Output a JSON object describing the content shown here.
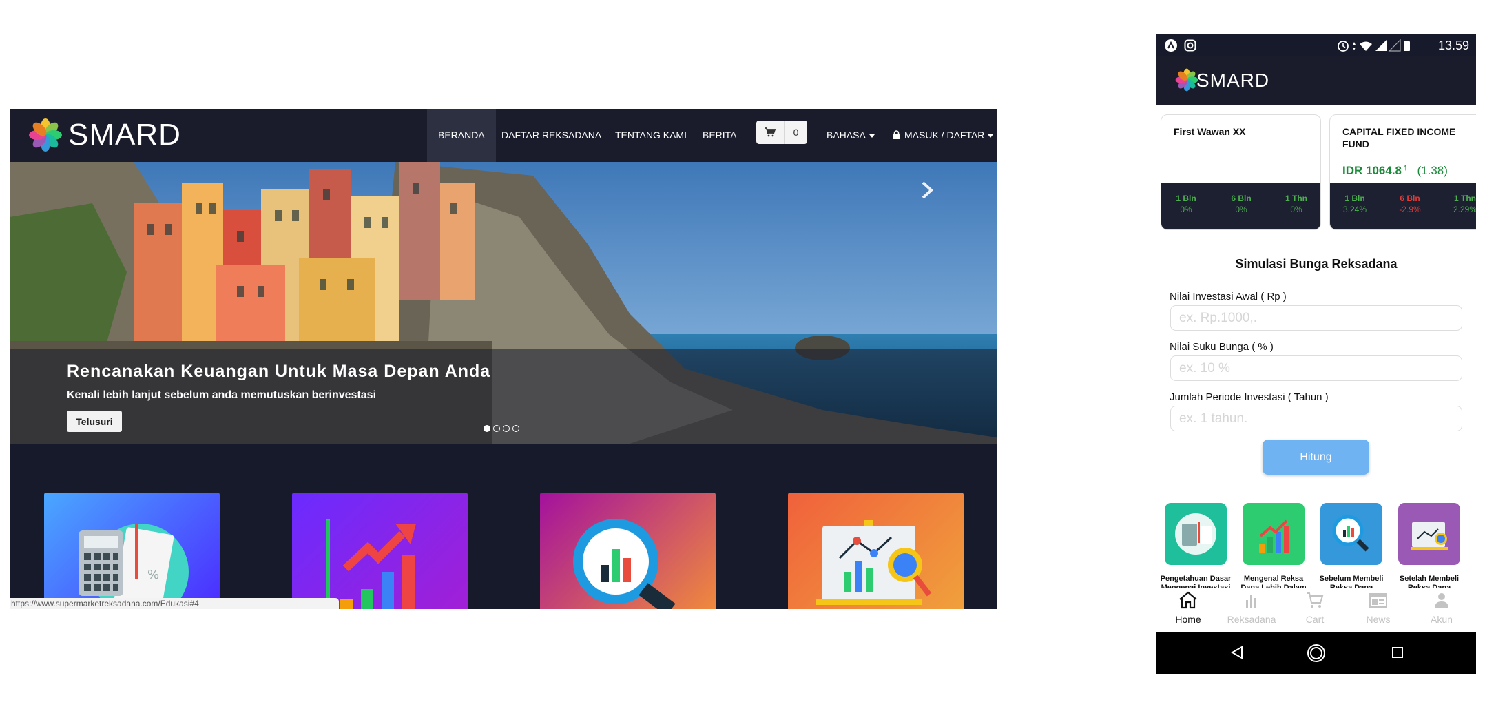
{
  "desktop": {
    "brand": "SMARD",
    "nav": {
      "beranda": "BERANDA",
      "daftar": "DAFTAR REKSADANA",
      "tentang": "TENTANG KAMI",
      "berita": "BERITA",
      "cart_count": "0",
      "bahasa": "BAHASA",
      "masuk": "MASUK / DAFTAR"
    },
    "hero": {
      "title": "Rencanakan Keuangan Untuk Masa Depan Anda",
      "subtitle": "Kenali lebih lanjut sebelum anda memutuskan berinvestasi",
      "button": "Telusuri",
      "active_slide": 1,
      "slide_count": 4
    },
    "status_url": "https://www.supermarketreksadana.com/Edukasi#4",
    "colors": {
      "nav_bg": "#1a1c2b",
      "page_bg": "#171a2a"
    },
    "tile_icons": [
      "calculator-icon",
      "growth-chart-icon",
      "magnifier-chart-icon",
      "presentation-board-icon"
    ]
  },
  "phone": {
    "status_time": "13.59",
    "brand": "SMARD",
    "funds": [
      {
        "name": "First Wawan XX",
        "stats": [
          {
            "label": "1 Bln",
            "value": "0%"
          },
          {
            "label": "6 Bln",
            "value": "0%"
          },
          {
            "label": "1 Thn",
            "value": "0%"
          }
        ]
      },
      {
        "name": "CAPITAL FIXED INCOME FUND",
        "price": "IDR 1064.8",
        "change": "(1.38)",
        "stats": [
          {
            "label": "1 Bln",
            "value": "3.24%"
          },
          {
            "label": "6 Bln",
            "value": "-2.9%"
          },
          {
            "label": "1 Thn",
            "value": "2.29%"
          }
        ]
      }
    ],
    "simulasi": {
      "title": "Simulasi Bunga Reksadana",
      "fields": [
        {
          "label": "Nilai Investasi Awal ( Rp )",
          "placeholder": "ex. Rp.1000,."
        },
        {
          "label": "Nilai Suku Bunga ( % )",
          "placeholder": "ex. 10 %"
        },
        {
          "label": "Jumlah Periode Investasi ( Tahun )",
          "placeholder": "ex. 1 tahun."
        }
      ],
      "button": "Hitung"
    },
    "edukasi": [
      {
        "label": "Pengetahuan Dasar Mengenai Investasi",
        "color": "#1fbf9c"
      },
      {
        "label": "Mengenal Reksa Dana Lebih Dalam",
        "color": "#2ecc71"
      },
      {
        "label": "Sebelum Membeli Reksa Dana",
        "color": "#3498db"
      },
      {
        "label": "Setelah Membeli Reksa Dana",
        "color": "#9b59b6"
      }
    ],
    "tabs": [
      {
        "label": "Home",
        "active": true
      },
      {
        "label": "Reksadana"
      },
      {
        "label": "Cart"
      },
      {
        "label": "News"
      },
      {
        "label": "Akun"
      }
    ]
  }
}
